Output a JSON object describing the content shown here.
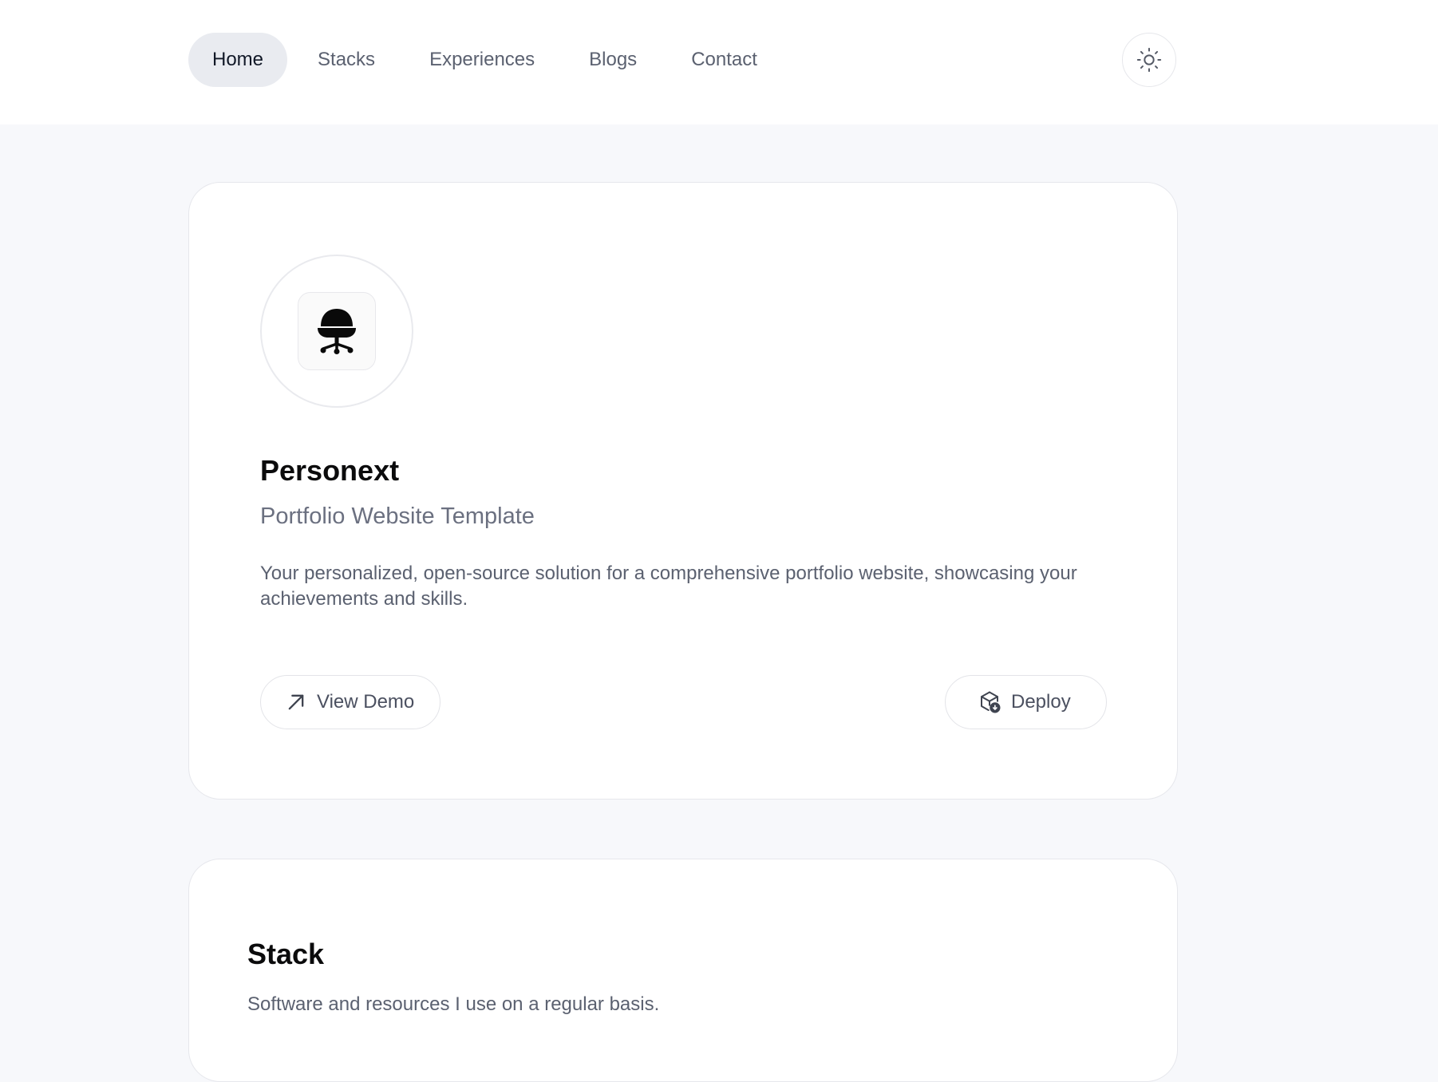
{
  "nav": {
    "items": [
      {
        "label": "Home",
        "active": true
      },
      {
        "label": "Stacks",
        "active": false
      },
      {
        "label": "Experiences",
        "active": false
      },
      {
        "label": "Blogs",
        "active": false
      },
      {
        "label": "Contact",
        "active": false
      }
    ],
    "theme_icon": "sun-icon"
  },
  "hero": {
    "logo_icon": "office-chair-icon",
    "title": "Personext",
    "subtitle": "Portfolio Website Template",
    "description": "Your personalized, open-source solution for a comprehensive portfolio website, showcasing your achievements and skills.",
    "demo_button": {
      "label": "View Demo",
      "icon": "arrow-up-right-icon"
    },
    "deploy_button": {
      "label": "Deploy",
      "icon": "package-deploy-icon"
    }
  },
  "stack": {
    "title": "Stack",
    "description": "Software and resources I use on a regular basis."
  },
  "colors": {
    "page_background": "#f7f8fb",
    "card_background": "#ffffff",
    "active_nav_background": "#e9ebf0",
    "muted_text": "#5b6170",
    "heading_text": "#0b0b0c"
  }
}
